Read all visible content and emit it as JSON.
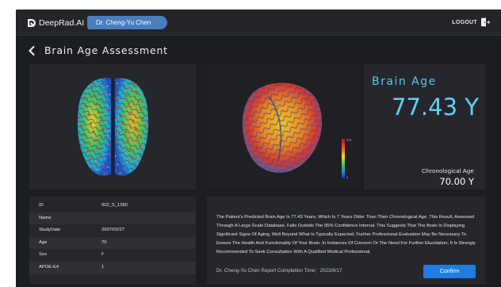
{
  "app": {
    "brand": "DeepRad.AI",
    "user": "Dr. Cheng-Yu Chen",
    "logout_label": "LOGOUT"
  },
  "page": {
    "title": "Brain Age Assessment"
  },
  "brain_age": {
    "title": "Brain Age",
    "value": "77.43 Y",
    "chronological_label": "Chronological Age",
    "chronological_value": "70.00 Y"
  },
  "colorbar": {
    "top_label": "0.75",
    "bottom_label": "0"
  },
  "patient_info": [
    {
      "key": "ID",
      "value": "002_S_1280"
    },
    {
      "key": "Name",
      "value": ""
    },
    {
      "key": "StudyDate",
      "value": "2007/02/27"
    },
    {
      "key": "Age",
      "value": "70"
    },
    {
      "key": "Sex",
      "value": "F"
    },
    {
      "key": "APOE-E4",
      "value": "1"
    }
  ],
  "report": {
    "text": "The Patient's Predicted Brain Age Is 77.43 Years, Which Is 7 Years Older Than Their Chronological Age. This Result, Assessed Through A Large-Scale Database, Falls Outside The 95% Confidence Interval. This Suggests That The Brain Is Displaying Significant Signs Of Aging, Well Beyond What Is Typically Expected. Further Professional Evaluation May Be Necessary To Ensure The Health And Functionality Of Your Brain. In Instances Of Concern Or The Need For Further Elucidation, It Is Strongly Recommended To Seek Consultation With A Qualified Medical Professional.",
    "footer": "Dr. Cheng-Yu Chen  Report Completion Time：2023/8/17",
    "confirm_label": "Confirm"
  },
  "colors": {
    "accent": "#5ac8ea",
    "button": "#1f7ce0",
    "user_pill": "#4a7dbd",
    "background": "#1b1d21"
  },
  "icons": {
    "logo": "deeprad-logo-icon",
    "logout": "logout-door-icon",
    "back": "chevron-left-icon"
  }
}
